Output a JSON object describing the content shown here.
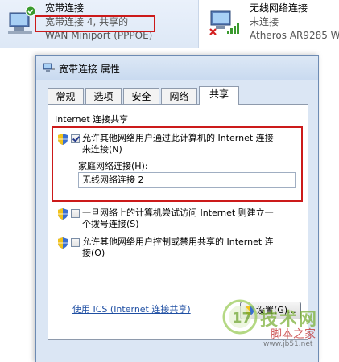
{
  "connections": [
    {
      "name": "宽带连接",
      "status": "宽带连接 4, 共享的",
      "device": "WAN Miniport (PPPOE)"
    },
    {
      "name": "无线网络连接",
      "status": "未连接",
      "device": "Atheros AR9285 Wi"
    }
  ],
  "dialog": {
    "title": "宽带连接 属性",
    "tabs": [
      "常规",
      "选项",
      "安全",
      "网络",
      "共享"
    ],
    "active_tab": "共享",
    "group_title": "Internet 连接共享",
    "option1": {
      "line1": "允许其他网络用户通过此计算机的 Internet 连接",
      "line2": "来连接(N)",
      "checked": true
    },
    "home_network_label": "家庭网络连接(H):",
    "home_network_value": "无线网络连接 2",
    "option2": {
      "line1": "一旦网络上的计算机尝试访问 Internet 则建立一",
      "line2": "个拨号连接(S)",
      "checked": false
    },
    "option3": {
      "line1": "允许其他网络用户控制或禁用共享的 Internet 连",
      "line2": "接(O)",
      "checked": false
    },
    "ics_link": "使用 ICS (Internet 连接共享)",
    "settings_button": "设置(G)..."
  },
  "watermark": {
    "line1": "技术网",
    "line2": "脚本之家",
    "line3": "www.jb51.net"
  },
  "colors": {
    "highlight": "#cc1a1a",
    "link": "#1f4fa3",
    "dialog_frame": "#dbe6f4"
  }
}
